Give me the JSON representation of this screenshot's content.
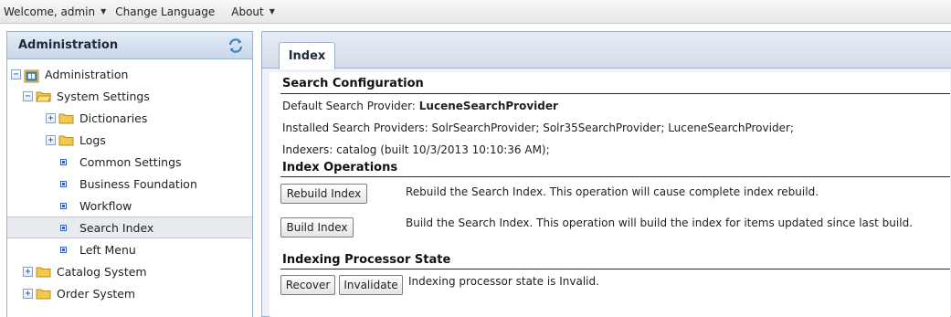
{
  "topbar": {
    "welcome": "Welcome, admin",
    "change_language": "Change Language",
    "about": "About"
  },
  "left_panel": {
    "title": "Administration",
    "tree": [
      {
        "label": "Administration",
        "level": 0,
        "type": "root",
        "expanded": true
      },
      {
        "label": "System Settings",
        "level": 1,
        "type": "folder",
        "expanded": true
      },
      {
        "label": "Dictionaries",
        "level": 2,
        "type": "folder",
        "expanded": false
      },
      {
        "label": "Logs",
        "level": 2,
        "type": "folder",
        "expanded": false
      },
      {
        "label": "Common Settings",
        "level": 2,
        "type": "leaf"
      },
      {
        "label": "Business Foundation",
        "level": 2,
        "type": "leaf"
      },
      {
        "label": "Workflow",
        "level": 2,
        "type": "leaf"
      },
      {
        "label": "Search Index",
        "level": 2,
        "type": "leaf",
        "selected": true
      },
      {
        "label": "Left Menu",
        "level": 2,
        "type": "leaf"
      },
      {
        "label": "Catalog System",
        "level": 1,
        "type": "folder",
        "expanded": false
      },
      {
        "label": "Order System",
        "level": 1,
        "type": "folder",
        "expanded": false
      }
    ]
  },
  "main": {
    "tab_label": "Index",
    "search_config": {
      "title": "Search Configuration",
      "default_provider_label": "Default Search Provider:",
      "default_provider_value": "LuceneSearchProvider",
      "installed_providers": "Installed Search Providers: SolrSearchProvider; Solr35SearchProvider; LuceneSearchProvider;",
      "indexers": "Indexers: catalog (built 10/3/2013 10:10:36 AM);"
    },
    "index_operations": {
      "title": "Index Operations",
      "rebuild_button": "Rebuild Index",
      "rebuild_desc": "Rebuild the Search Index. This operation will cause complete index rebuild.",
      "build_button": "Build Index",
      "build_desc": "Build the Search Index. This operation will build the index for items updated since last build."
    },
    "processor_state": {
      "title": "Indexing Processor State",
      "recover_button": "Recover",
      "invalidate_button": "Invalidate",
      "state_text": "Indexing processor state is Invalid."
    }
  },
  "colors": {
    "panel_border": "#9fb1c8",
    "header_gradient_top": "#e4ecf6",
    "header_gradient_bottom": "#c9d7ea",
    "folder_yellow": "#f3c94d",
    "selected_row": "#e8ebf0"
  },
  "icons": {
    "refresh": "refresh-icon",
    "root": "administration-root-icon",
    "folder": "folder-icon",
    "leaf": "page-node-icon"
  }
}
